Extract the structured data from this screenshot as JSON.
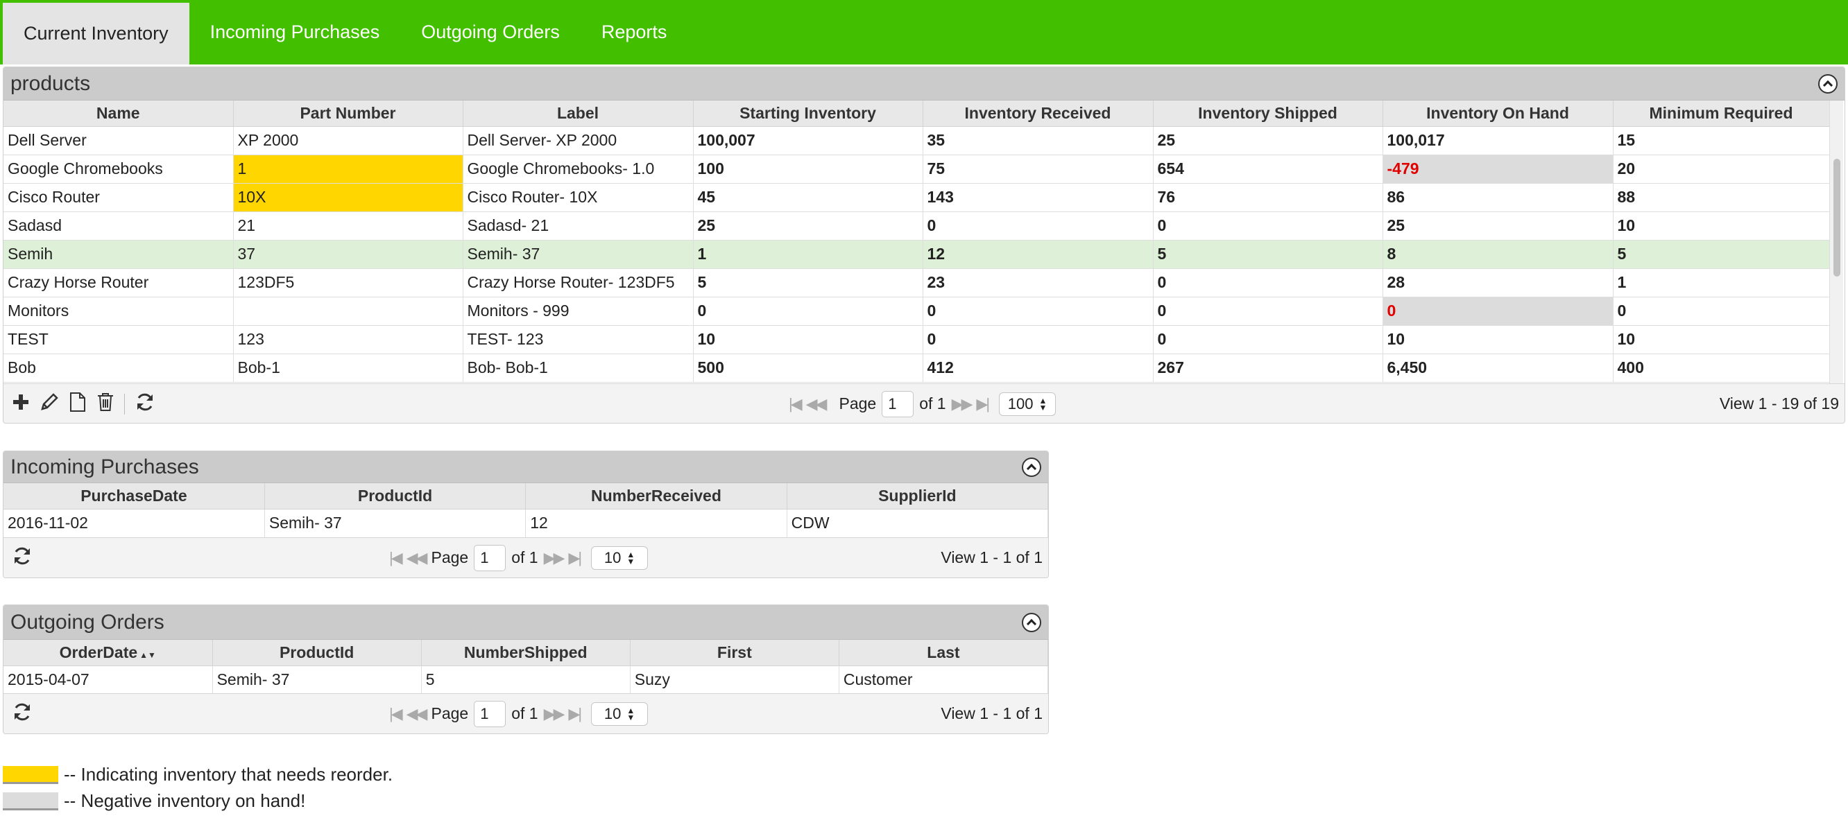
{
  "nav": {
    "tabs": [
      {
        "label": "Current Inventory",
        "active": true
      },
      {
        "label": "Incoming Purchases"
      },
      {
        "label": "Outgoing Orders"
      },
      {
        "label": "Reports"
      }
    ]
  },
  "products": {
    "title": "products",
    "columns": [
      "Name",
      "Part Number",
      "Label",
      "Starting Inventory",
      "Inventory Received",
      "Inventory Shipped",
      "Inventory On Hand",
      "Minimum Required"
    ],
    "rows": [
      {
        "name": "Dell Server",
        "part": "XP 2000",
        "label": "Dell Server- XP 2000",
        "start": "100,007",
        "received": "35",
        "shipped": "25",
        "onhand": "100,017",
        "min": "15"
      },
      {
        "name": "Google Chromebooks",
        "part": "1",
        "label": "Google Chromebooks- 1.0",
        "start": "100",
        "received": "75",
        "shipped": "654",
        "onhand": "-479",
        "min": "20",
        "reorder": true,
        "negative": true
      },
      {
        "name": "Cisco Router",
        "part": "10X",
        "label": "Cisco Router- 10X",
        "start": "45",
        "received": "143",
        "shipped": "76",
        "onhand": "86",
        "min": "88",
        "reorder": true
      },
      {
        "name": "Sadasd",
        "part": "21",
        "label": "Sadasd- 21",
        "start": "25",
        "received": "0",
        "shipped": "0",
        "onhand": "25",
        "min": "10"
      },
      {
        "name": "Semih",
        "part": "37",
        "label": "Semih- 37",
        "start": "1",
        "received": "12",
        "shipped": "5",
        "onhand": "8",
        "min": "5",
        "selected": true
      },
      {
        "name": "Crazy Horse Router",
        "part": "123DF5",
        "label": "Crazy Horse Router- 123DF5",
        "start": "5",
        "received": "23",
        "shipped": "0",
        "onhand": "28",
        "min": "1"
      },
      {
        "name": "Monitors",
        "part": "",
        "label": "Monitors - 999",
        "start": "0",
        "received": "0",
        "shipped": "0",
        "onhand": "0",
        "min": "0",
        "negative": true
      },
      {
        "name": "TEST",
        "part": "123",
        "label": "TEST- 123",
        "start": "10",
        "received": "0",
        "shipped": "0",
        "onhand": "10",
        "min": "10"
      },
      {
        "name": "Bob",
        "part": "Bob-1",
        "label": "Bob- Bob-1",
        "start": "500",
        "received": "412",
        "shipped": "267",
        "onhand": "6,450",
        "min": "400"
      }
    ],
    "pager": {
      "page_label": "Page",
      "page": "1",
      "of_label": "of 1",
      "page_size": "100",
      "view": "View 1 - 19 of 19"
    },
    "toolbar_icons": [
      "add-icon",
      "edit-icon",
      "view-icon",
      "delete-icon",
      "refresh-icon"
    ]
  },
  "purchases": {
    "title": "Incoming Purchases",
    "columns": [
      "PurchaseDate",
      "ProductId",
      "NumberReceived",
      "SupplierId"
    ],
    "rows": [
      {
        "date": "2016-11-02",
        "product": "Semih- 37",
        "number": "12",
        "supplier": "CDW"
      }
    ],
    "pager": {
      "page_label": "Page",
      "page": "1",
      "of_label": "of 1",
      "page_size": "10",
      "view": "View 1 - 1 of 1"
    }
  },
  "orders": {
    "title": "Outgoing Orders",
    "columns": [
      "OrderDate",
      "ProductId",
      "NumberShipped",
      "First",
      "Last"
    ],
    "rows": [
      {
        "date": "2015-04-07",
        "product": "Semih- 37",
        "number": "5",
        "first": "Suzy",
        "last": "Customer"
      }
    ],
    "pager": {
      "page_label": "Page",
      "page": "1",
      "of_label": "of 1",
      "page_size": "10",
      "view": "View 1 - 1 of 1"
    }
  },
  "legend": {
    "reorder_text": "-- Indicating inventory that needs reorder.",
    "negative_text": "-- Negative inventory on hand!"
  },
  "colors": {
    "nav_bg": "#42c000",
    "reorder": "#ffd600",
    "negative_bg": "#dcdcdc",
    "negative_text": "#e00000",
    "selected_row": "#dff0d8"
  }
}
